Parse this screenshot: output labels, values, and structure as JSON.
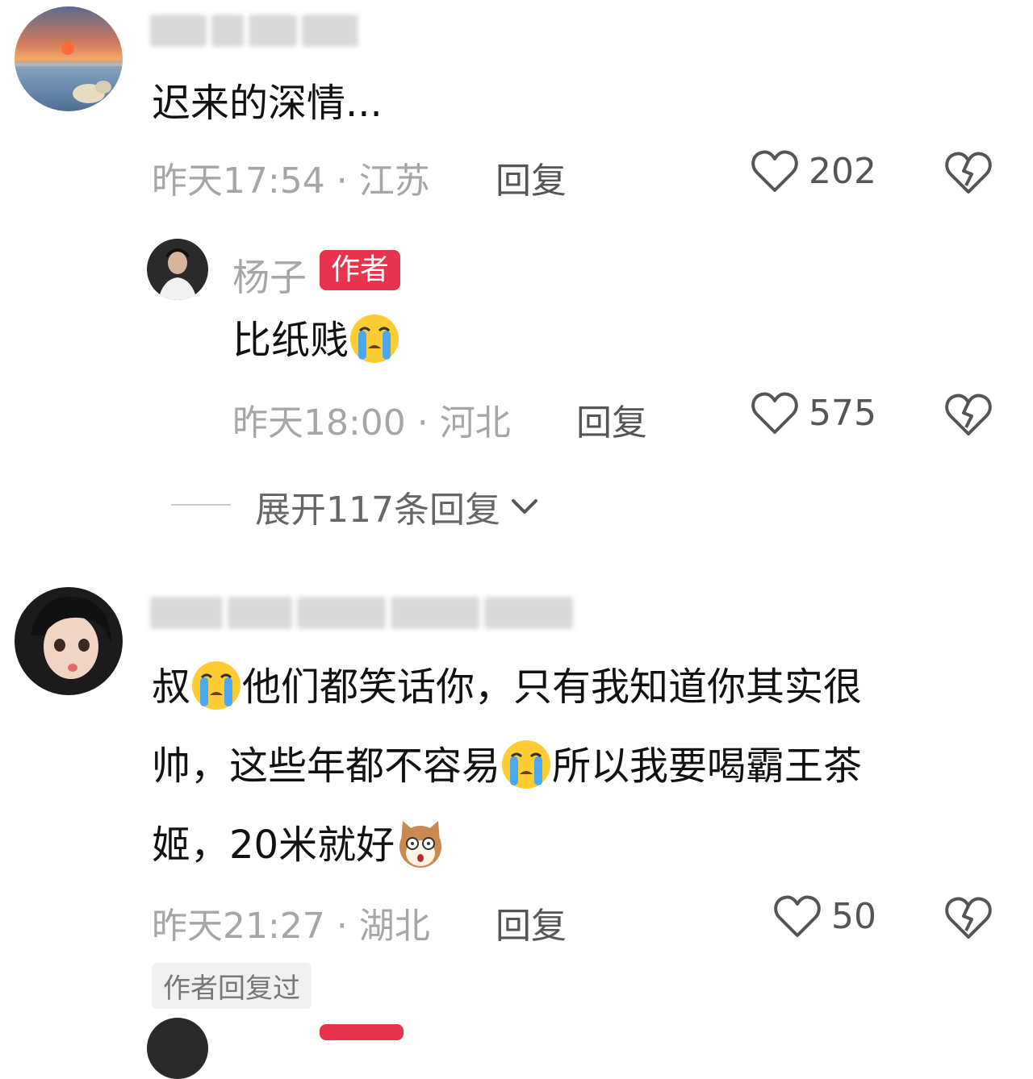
{
  "comments": [
    {
      "text": "迟来的深情...",
      "time_location": "昨天17:54 · 江苏",
      "reply_label": "回复",
      "likes": "202"
    },
    {
      "username": "杨子",
      "tag": "作者",
      "text": "比纸贱",
      "time_location": "昨天18:00 · 河北",
      "reply_label": "回复",
      "likes": "575"
    },
    {
      "text_line1_a": "叔",
      "text_line1_b": "他们都笑话你，只有我知道你其实很",
      "text_line2_a": "帅，这些年都不容易",
      "text_line2_b": "所以我要喝霸王茶",
      "text_line3": "姬，20米就好",
      "time_location": "昨天21:27 · 湖北",
      "reply_label": "回复",
      "likes": "50",
      "author_replied_badge": "作者回复过"
    }
  ],
  "expand_replies": "展开117条回复",
  "icons": {
    "like": "heart-outline-icon",
    "dislike": "broken-heart-icon",
    "crying_emoji": "crying-face-emoji",
    "dog_emoji": "surprised-dog-emoji",
    "expand": "chevron-down-icon"
  },
  "colors": {
    "author_tag": "#e8344e",
    "meta_text": "#a6a6a6"
  }
}
